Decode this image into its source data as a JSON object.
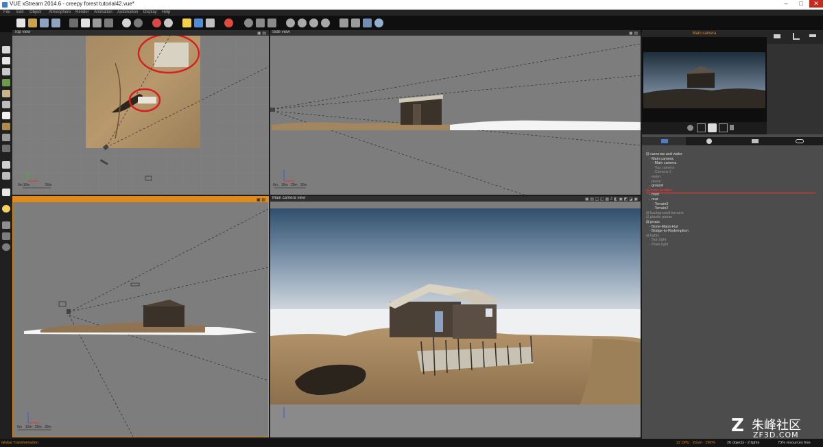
{
  "window": {
    "title": "VUE xStream 2014.6 - creepy forest tutorial42.vue*",
    "controls": [
      "–",
      "□",
      "✕"
    ]
  },
  "menu": [
    "File",
    "Edit",
    "Object",
    "Atmosphere",
    "Render",
    "Animation",
    "Automation",
    "Display",
    "Help"
  ],
  "viewports": {
    "top": {
      "title": "Top view",
      "scale": [
        "0m",
        "10m",
        "",
        "50m"
      ]
    },
    "side": {
      "title": "Side view",
      "scale": [
        "0m",
        "10m",
        "20m",
        "30m"
      ]
    },
    "front": {
      "title": "",
      "scale": [
        "0m",
        "10m",
        "20m",
        "30m"
      ]
    },
    "camera": {
      "title": "Main camera view"
    }
  },
  "camera_panel": {
    "title": "Main camera"
  },
  "world_browser": {
    "items": [
      {
        "label": "cameras and water",
        "style": "normal",
        "indent": 0
      },
      {
        "label": "Main camera",
        "style": "normal",
        "indent": 1
      },
      {
        "label": "Main camera",
        "style": "normal",
        "indent": 2
      },
      {
        "label": "Top camera",
        "style": "dim",
        "indent": 2
      },
      {
        "label": "Camera 1",
        "style": "dim",
        "indent": 2
      },
      {
        "label": "water",
        "style": "dim",
        "indent": 1
      },
      {
        "label": "plane",
        "style": "dim",
        "indent": 1
      },
      {
        "label": "ground",
        "style": "normal",
        "indent": 1
      },
      {
        "label": "main terrains",
        "style": "red",
        "indent": 0
      },
      {
        "label": "front",
        "style": "normal",
        "indent": 1
      },
      {
        "label": "rear",
        "style": "normal",
        "indent": 1
      },
      {
        "label": "Terrain3",
        "style": "normal",
        "indent": 2
      },
      {
        "label": "Terrain2",
        "style": "normal",
        "indent": 2
      },
      {
        "label": "background terrains",
        "style": "dim",
        "indent": 0
      },
      {
        "label": "plastic plants",
        "style": "dim",
        "indent": 0
      },
      {
        "label": "props",
        "style": "normal",
        "indent": 0
      },
      {
        "label": "Bone-Mans-Hut",
        "style": "normal",
        "indent": 1
      },
      {
        "label": "Bridge-to-Redemption",
        "style": "normal",
        "indent": 1
      },
      {
        "label": "lights",
        "style": "dim",
        "indent": 0
      },
      {
        "label": "Sun light",
        "style": "dim",
        "indent": 1
      },
      {
        "label": "Point light",
        "style": "dim",
        "indent": 1
      }
    ]
  },
  "status": {
    "left": "Global Transformation",
    "cpu": "12 CPU",
    "zoom": "Zoom : 292%",
    "objects": "26 objects - 2 lights",
    "resources": "73% resources free"
  },
  "watermark": {
    "brand": "朱峰社区",
    "url": "ZF3D.COM"
  },
  "colors": {
    "accent": "#e08a1a",
    "selection": "#ff3b3b",
    "sky_top": "#2f4f6e",
    "sand": "#a8885c"
  }
}
